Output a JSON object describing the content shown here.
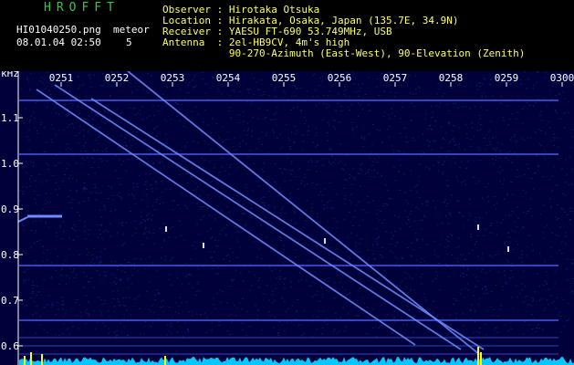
{
  "header": {
    "brand": "HROFFT",
    "filename": "HI01040250.png",
    "datetime": "08.01.04 02:50",
    "meteor_label": "meteor",
    "meteor_count": "5",
    "info_lines": [
      "Observer : Hirotaka Otsuka",
      "Location : Hirakata, Osaka, Japan (135.7E, 34.9N)",
      "Receiver : YAESU FT-690 53.749MHz, USB",
      "Antenna  : 2el-HB9CV, 4m's high",
      "           90-270-Azimuth (East-West), 90-Elevation (Zenith)"
    ]
  },
  "plot": {
    "unit_label": "kHz",
    "time_ticks": [
      "0251",
      "0252",
      "0253",
      "0254",
      "0255",
      "0256",
      "0257",
      "0258",
      "0259",
      "0300"
    ],
    "freq_ticks": [
      "1.1",
      "1.0",
      "0.9",
      "0.8",
      "0.7",
      "0.6"
    ],
    "colors": {
      "background": "#00003a",
      "noise": "#1a3aa0",
      "trace": "#6f8cff",
      "carrier": "#4a66ff",
      "spectrum": "#00c8ff",
      "meteor_spike": "#ffff00",
      "axis": "#ffffff"
    }
  }
}
